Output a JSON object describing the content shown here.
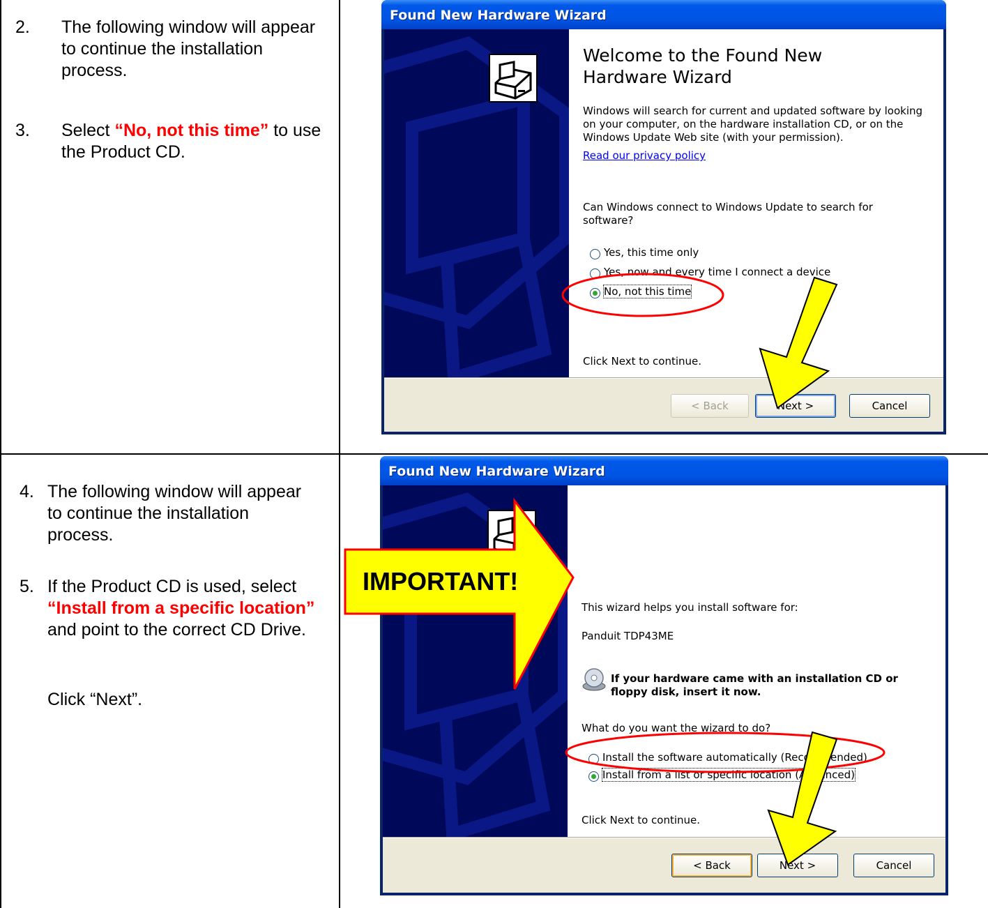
{
  "row1": {
    "steps": [
      {
        "num": "2.",
        "text": "The following window will appear to continue the installation process."
      },
      {
        "num": "3.",
        "pre": "Select ",
        "highlight": "“No, not this time”",
        "post": " to use the Product CD."
      }
    ],
    "wizard": {
      "title": "Found New Hardware Wizard",
      "heading": "Welcome to the Found New Hardware Wizard",
      "description": "Windows will search for current and updated software by looking on your computer, on the hardware installation CD, or on the Windows Update Web site (with your permission).",
      "privacy_link": "Read our privacy policy",
      "question": "Can Windows connect to Windows Update to search for software?",
      "options": [
        {
          "label": "Yes, this time only",
          "selected": false
        },
        {
          "label": "Yes, now and every time I connect a device",
          "selected": false
        },
        {
          "label": "No, not this time",
          "selected": true
        }
      ],
      "continue_text": "Click Next to continue.",
      "buttons": {
        "back": "< Back",
        "next": "Next >",
        "cancel": "Cancel"
      }
    }
  },
  "row2": {
    "steps": [
      {
        "num": "4.",
        "text": "The following window will appear to continue the installation process."
      },
      {
        "num": "5.",
        "pre": "If the Product CD is used, select ",
        "highlight": "“Install from a specific location”",
        "post": " and point to the correct CD Drive."
      }
    ],
    "click_next": "Click “Next”.",
    "callout": "IMPORTANT!",
    "wizard": {
      "title": "Found New Hardware Wizard",
      "intro": "This wizard helps you install software for:",
      "device": "Panduit TDP43ME",
      "cd_notice": "If your hardware came with an installation CD or floppy disk, insert it now.",
      "question": "What do you want the wizard to do?",
      "options": [
        {
          "label": "Install the software automatically (Recommended)",
          "selected": false
        },
        {
          "label": "Install from a list or specific location (Advanced)",
          "selected": true
        }
      ],
      "continue_text": "Click Next to continue.",
      "buttons": {
        "back": "< Back",
        "next": "Next >",
        "cancel": "Cancel"
      }
    }
  },
  "colors": {
    "highlight": "#ff0000",
    "arrow": "#ffff00",
    "callout_fill": "#ffff00",
    "xp_title": "#0054e3",
    "sidebar": "#00085a"
  }
}
